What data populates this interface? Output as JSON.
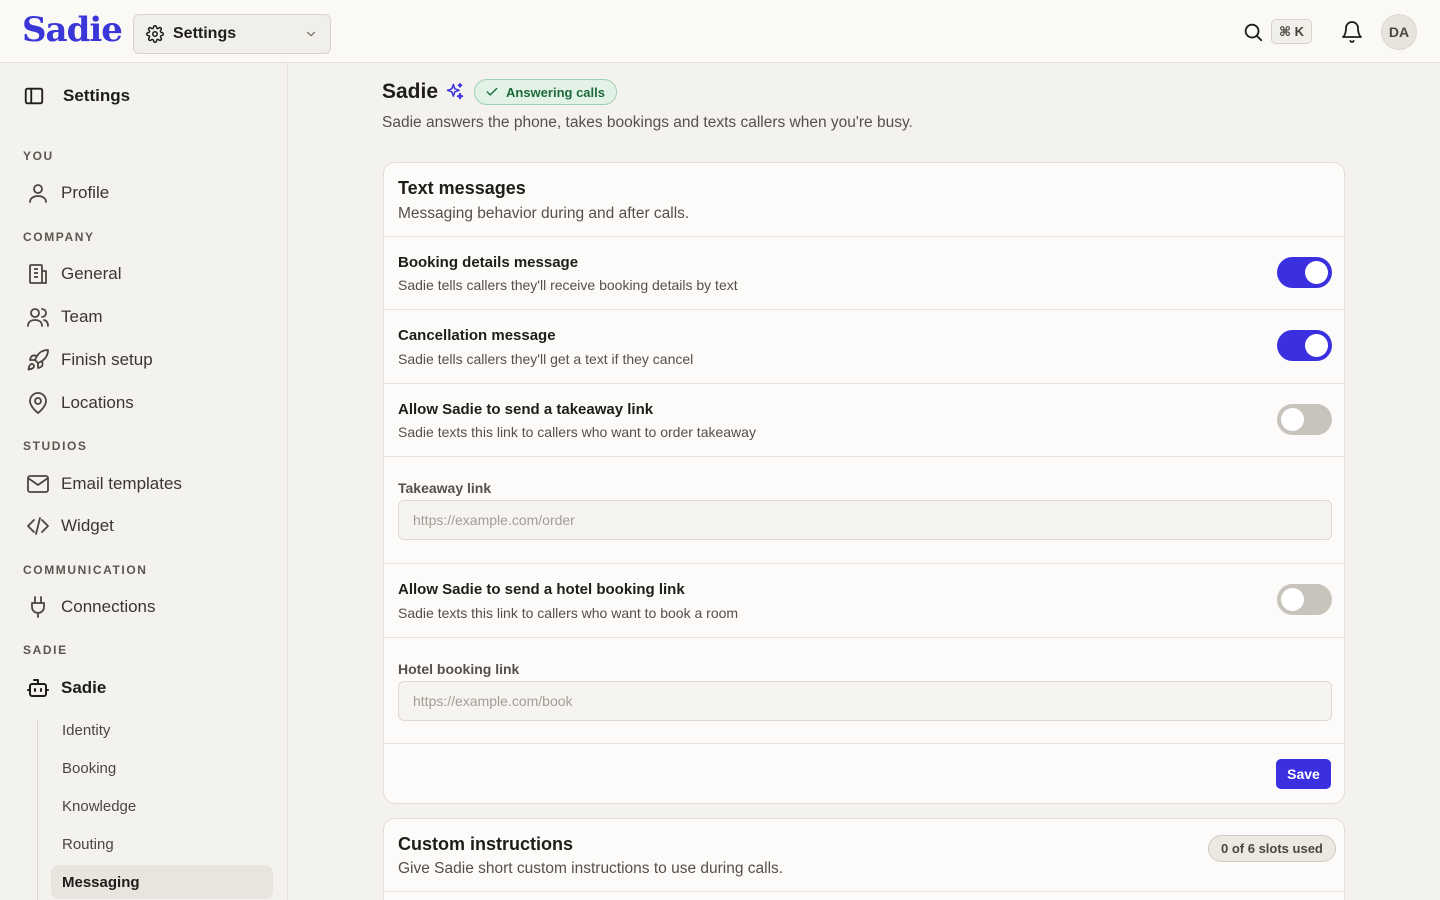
{
  "app": {
    "logo": "Sadie",
    "workspace_select": "Settings",
    "shortcut": "⌘ K",
    "avatar_initials": "DA",
    "brand_color": "#3b36d8"
  },
  "sidebar": {
    "title": "Settings",
    "sections": {
      "you": "YOU",
      "company": "COMPANY",
      "studios": "STUDIOS",
      "communication": "COMMUNICATION",
      "sadie": "SADIE"
    },
    "items": {
      "profile": "Profile",
      "general": "General",
      "team": "Team",
      "finish_setup": "Finish setup",
      "locations": "Locations",
      "email_templates": "Email templates",
      "widget": "Widget",
      "connections": "Connections",
      "sadie": "Sadie"
    },
    "sub_items": [
      "Identity",
      "Booking",
      "Knowledge",
      "Routing",
      "Messaging"
    ],
    "active_sub_item": "Messaging"
  },
  "page": {
    "title": "Sadie",
    "status_badge": "Answering calls",
    "description": "Sadie answers the phone, takes bookings and texts callers when you're busy."
  },
  "text_messages": {
    "title": "Text messages",
    "description": "Messaging behavior during and after calls.",
    "rows": [
      {
        "title": "Booking details message",
        "description": "Sadie tells callers they'll receive booking details by text",
        "enabled": true
      },
      {
        "title": "Cancellation message",
        "description": "Sadie tells callers they'll get a text if they cancel",
        "enabled": true
      },
      {
        "title": "Allow Sadie to send a takeaway link",
        "description": "Sadie texts this link to callers who want to order takeaway",
        "enabled": false
      },
      {
        "title": "Allow Sadie to send a hotel booking link",
        "description": "Sadie texts this link to callers who want to book a room",
        "enabled": false
      }
    ],
    "takeaway_field": {
      "label": "Takeaway link",
      "placeholder": "https://example.com/order",
      "value": ""
    },
    "hotel_field": {
      "label": "Hotel booking link",
      "placeholder": "https://example.com/book",
      "value": ""
    },
    "save_label": "Save"
  },
  "custom_instructions": {
    "title": "Custom instructions",
    "description": "Give Sadie short custom instructions to use during calls.",
    "slots_badge": "0 of 6 slots used"
  }
}
